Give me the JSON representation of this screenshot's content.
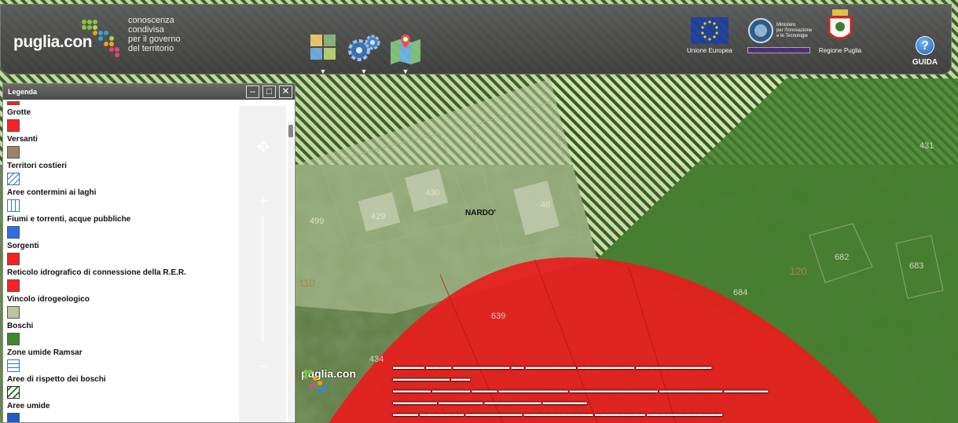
{
  "header": {
    "brand_name": "puglia.con",
    "brand_tagline": [
      "conoscenza",
      "condivisa",
      "per il governo",
      "del territorio"
    ],
    "tools": [
      {
        "icon": "layers-icon"
      },
      {
        "icon": "gears-icon"
      },
      {
        "icon": "map-pin-icon"
      }
    ],
    "sponsors": [
      {
        "label": "Unione Europea",
        "icon": "eu-flag-icon"
      },
      {
        "label": "",
        "icon": "ministry-logo-icon",
        "text_lines": [
          "Ministero",
          "per l'Innovazione",
          "e le Tecnologie"
        ]
      },
      {
        "label": "Regione Puglia",
        "icon": "regione-puglia-crest-icon"
      }
    ],
    "guida_label": "GUIDA"
  },
  "legend": {
    "title": "Legenda",
    "items": [
      {
        "name": "Grotte",
        "color": "#ff1f1f",
        "pattern": "solid"
      },
      {
        "name": "Versanti",
        "color": "#9c8468",
        "pattern": "solid"
      },
      {
        "name": "Territori costieri",
        "color": "#ffffff",
        "pattern": "diag-blue"
      },
      {
        "name": "Aree contermini ai laghi",
        "color": "#ffffff",
        "pattern": "vert-blue"
      },
      {
        "name": "Fiumi e torrenti, acque pubbliche",
        "color": "#2b6ee8",
        "pattern": "solid"
      },
      {
        "name": "Sorgenti",
        "color": "#ff1f1f",
        "pattern": "solid"
      },
      {
        "name": "Reticolo idrografico di connessione della R.E.R.",
        "color": "#ff1f1f",
        "pattern": "solid"
      },
      {
        "name": "Vincolo idrogeologico",
        "color": "#b7c79a",
        "pattern": "solid"
      },
      {
        "name": "Boschi",
        "color": "#3a8a26",
        "pattern": "solid"
      },
      {
        "name": "Zone umide Ramsar",
        "color": "#ffffff",
        "pattern": "horiz-blue"
      },
      {
        "name": "Aree di rispetto dei boschi",
        "color": "#ffffff",
        "pattern": "diag-green"
      },
      {
        "name": "Aree umide",
        "color": "#1e5cc8",
        "pattern": "solid"
      }
    ]
  },
  "map": {
    "town_label": "NARDO'",
    "parcels": [
      "429",
      "430",
      "46",
      "682",
      "683",
      "684",
      "499",
      "431",
      "639",
      "434"
    ],
    "zone_numbers": [
      "110",
      "120"
    ],
    "logo_text": "puglia.con",
    "colors": {
      "buffer_zone": "#e81c1c",
      "forest": "#3f7d2a",
      "light_zone": "#b9c89f",
      "hatch_green": "#2f5d1d",
      "hatch_light": "#d8e2b8"
    }
  }
}
